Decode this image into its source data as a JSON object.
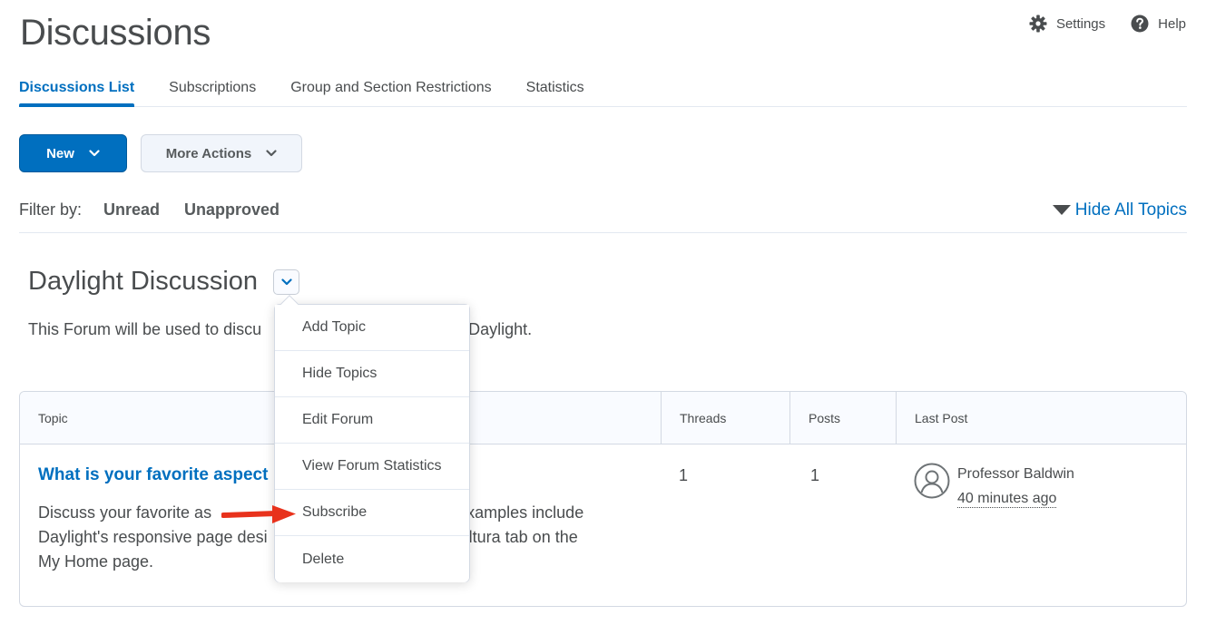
{
  "header": {
    "title": "Discussions",
    "settings_label": "Settings",
    "help_label": "Help"
  },
  "tabs": [
    {
      "label": "Discussions List",
      "active": true
    },
    {
      "label": "Subscriptions",
      "active": false
    },
    {
      "label": "Group and Section Restrictions",
      "active": false
    },
    {
      "label": "Statistics",
      "active": false
    }
  ],
  "toolbar": {
    "new_label": "New",
    "more_actions_label": "More Actions"
  },
  "filter": {
    "label": "Filter by:",
    "unread": "Unread",
    "unapproved": "Unapproved",
    "hide_all_topics": "Hide All Topics"
  },
  "forum": {
    "title": "Daylight Discussion",
    "description_left": "This Forum will be used to discu",
    "description_right": "Daylight."
  },
  "table": {
    "headers": {
      "topic": "Topic",
      "threads": "Threads",
      "posts": "Posts",
      "last_post": "Last Post"
    },
    "rows": [
      {
        "topic_title": "What is your favorite aspect",
        "description_lines": [
          "Discuss your favorite as                                             face. Examples include",
          "Daylight's responsive page desi                                     e Kaltura tab on the",
          "My Home page."
        ],
        "threads": "1",
        "posts": "1",
        "last_post_author": "Professor Baldwin",
        "last_post_time": "40 minutes ago"
      }
    ]
  },
  "dropdown": {
    "items": [
      "Add Topic",
      "Hide Topics",
      "Edit Forum",
      "View Forum Statistics",
      "Subscribe",
      "Delete"
    ]
  },
  "colors": {
    "accent": "#006fbf",
    "annotation_arrow": "#e8321c"
  },
  "icons": [
    "gear-icon",
    "help-icon",
    "chevron-down-icon",
    "triangle-down-icon",
    "user-avatar-icon",
    "red-arrow-annotation"
  ]
}
